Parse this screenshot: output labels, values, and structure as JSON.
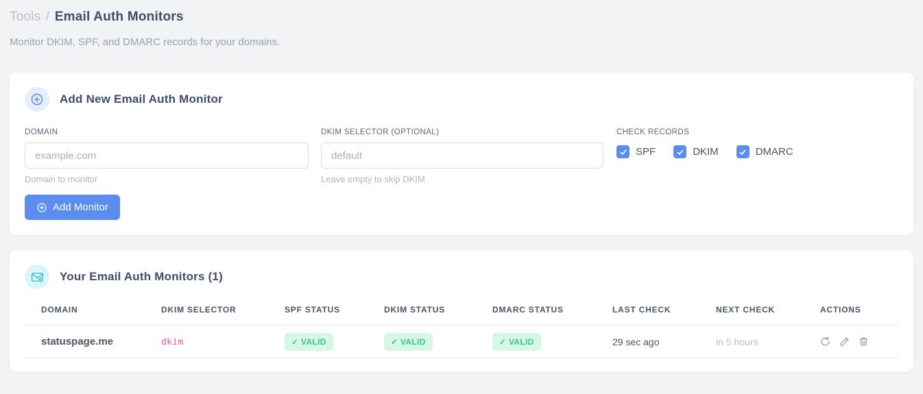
{
  "page": {
    "breadcrumb_section": "Tools",
    "breadcrumb_separator": "/",
    "title": "Email Auth Monitors",
    "subtitle": "Monitor DKIM, SPF, and DMARC records for your domains."
  },
  "add_monitor_card": {
    "title": "Add New Email Auth Monitor",
    "domain_field": {
      "label": "DOMAIN",
      "placeholder": "example.com",
      "value": "",
      "hint": "Domain to monitor"
    },
    "dkim_field": {
      "label": "DKIM SELECTOR (OPTIONAL)",
      "placeholder": "default",
      "value": "",
      "hint": "Leave empty to skip DKIM"
    },
    "check_records": {
      "label": "CHECK RECORDS",
      "options": [
        {
          "label": "SPF",
          "checked": true
        },
        {
          "label": "DKIM",
          "checked": true
        },
        {
          "label": "DMARC",
          "checked": true
        }
      ]
    },
    "submit_label": "Add Monitor"
  },
  "monitors_card": {
    "title": "Your Email Auth Monitors (1)",
    "table": {
      "columns": [
        "DOMAIN",
        "DKIM SELECTOR",
        "SPF STATUS",
        "DKIM STATUS",
        "DMARC STATUS",
        "LAST CHECK",
        "NEXT CHECK",
        "ACTIONS"
      ],
      "rows": [
        {
          "domain": "statuspage.me",
          "dkim_selector": "dkim",
          "spf_status": "✓ VALID",
          "dkim_status": "✓ VALID",
          "dmarc_status": "✓ VALID",
          "last_check": "29 sec ago",
          "next_check": "in 5 hours"
        }
      ]
    }
  },
  "icons": {
    "add_card_badge": "plus-circle-icon",
    "monitors_card_badge": "envelope-check-icon",
    "button_icon": "plus-circle-icon",
    "row_actions": [
      "refresh-icon",
      "edit-pencil-icon",
      "trash-icon"
    ]
  },
  "colors": {
    "accent_blue": "#5a8dee",
    "accent_blue_bg": "#e7edfc",
    "teal": "#27c5d8",
    "teal_bg": "#dcf5f8",
    "success_text": "#30c985",
    "success_bg": "#d8f6e6",
    "selector_pink": "#f25c8e",
    "title_dark": "#3f4c67",
    "page_bg": "#f2f3f5"
  }
}
